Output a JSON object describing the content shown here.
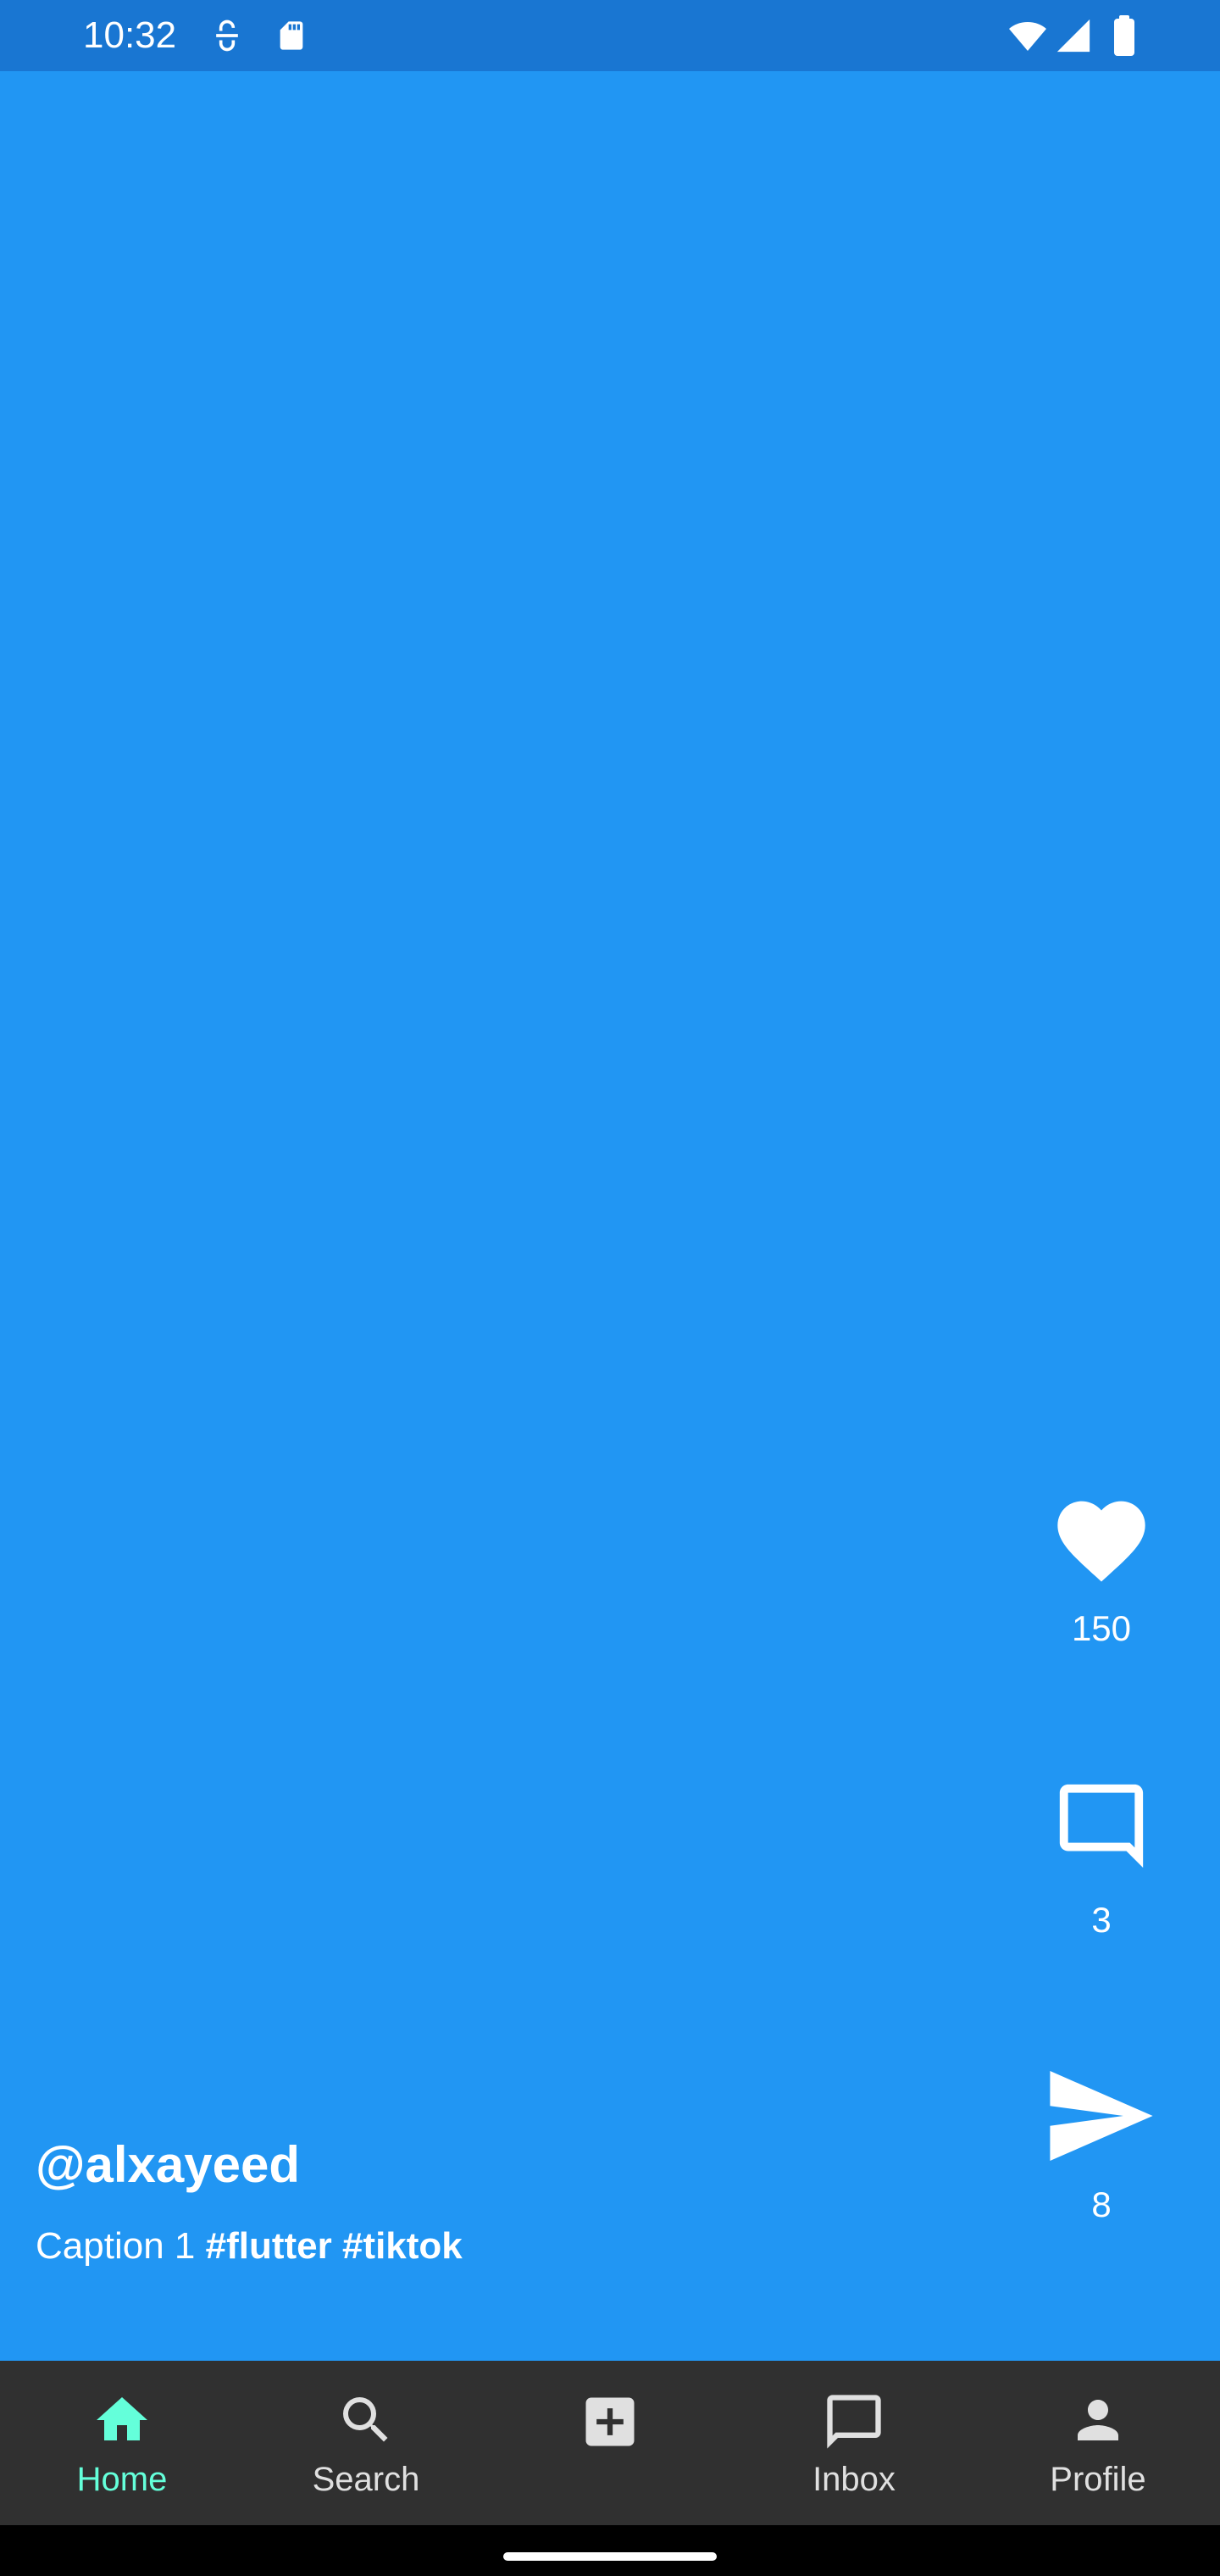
{
  "status_bar": {
    "time": "10:32"
  },
  "post": {
    "username": "@alxayeed",
    "caption_text": "Caption 1",
    "hashtags": [
      "#flutter",
      "#tiktok"
    ]
  },
  "actions": {
    "likes": "150",
    "comments": "3",
    "shares": "8"
  },
  "nav": {
    "items": [
      {
        "label": "Home",
        "icon": "home-icon"
      },
      {
        "label": "Search",
        "icon": "search-icon"
      },
      {
        "label": "",
        "icon": "add-box-icon"
      },
      {
        "label": "Inbox",
        "icon": "message-icon"
      },
      {
        "label": "Profile",
        "icon": "person-icon"
      }
    ]
  },
  "colors": {
    "background": "#2196F3",
    "status_bar": "#1976D2",
    "nav_bar": "#303030",
    "active": "#64FFDA"
  }
}
